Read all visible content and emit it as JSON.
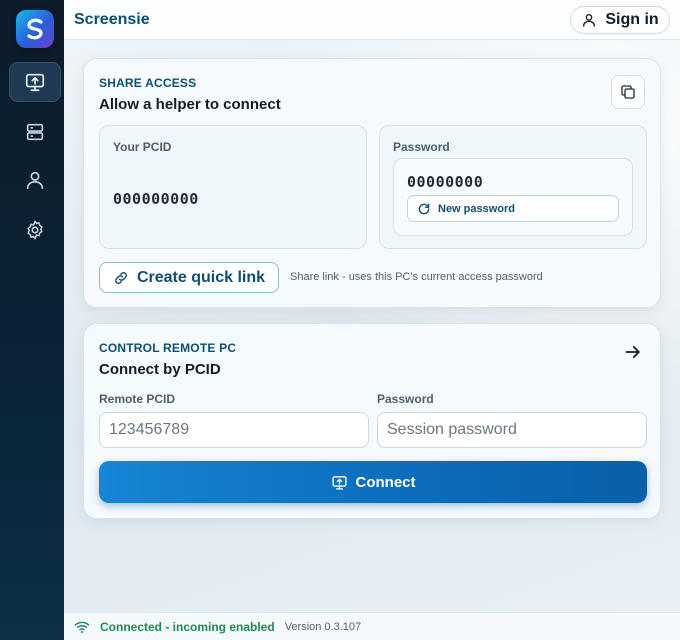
{
  "app": {
    "title": "Screensie",
    "logo_icon": "s-logo-icon",
    "accent": "#0c6fbf",
    "brand_dark": "#0d4f74"
  },
  "header": {
    "signin_label": "Sign in",
    "signin_icon": "user-icon"
  },
  "sidebar": {
    "items": [
      {
        "name": "share-screen",
        "icon": "monitor-upload-icon",
        "active": true
      },
      {
        "name": "devices",
        "icon": "server-icon",
        "active": false
      },
      {
        "name": "account",
        "icon": "user-icon",
        "active": false
      },
      {
        "name": "settings",
        "icon": "gear-icon",
        "active": false
      }
    ]
  },
  "share": {
    "eyebrow": "SHARE ACCESS",
    "title": "Allow a helper to connect",
    "copy_icon": "copy-icon",
    "pcid_label": "Your PCID",
    "pcid_value": "000000000",
    "password_label": "Password",
    "password_value": "00000000",
    "new_password_label": "New password",
    "quick_link_label": "Create quick link",
    "quick_link_note": "Share link - uses this PC's current access password"
  },
  "control": {
    "eyebrow": "CONTROL REMOTE PC",
    "title": "Connect by PCID",
    "remote_pcid_label": "Remote PCID",
    "remote_pcid_placeholder": "123456789",
    "password_label": "Password",
    "password_placeholder": "Session password",
    "connect_label": "Connect"
  },
  "status": {
    "text": "Connected - incoming enabled",
    "version": "Version 0.3.107",
    "color": "#1c8a55"
  }
}
